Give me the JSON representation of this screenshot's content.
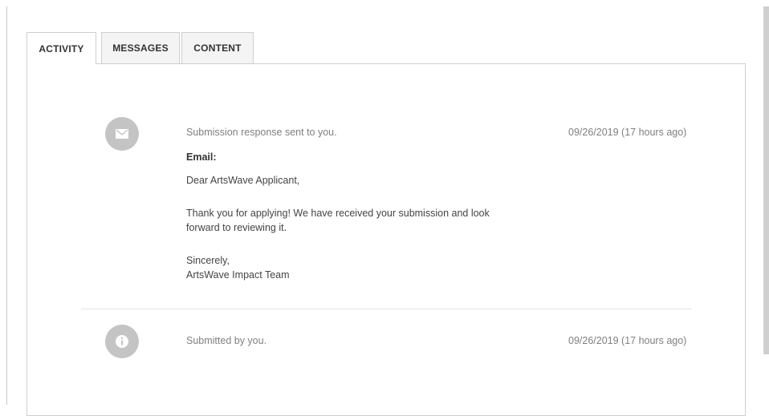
{
  "tabs": [
    {
      "label": "ACTIVITY",
      "active": true
    },
    {
      "label": "MESSAGES",
      "active": false
    },
    {
      "label": "CONTENT",
      "active": false
    }
  ],
  "activity": [
    {
      "icon": "envelope-icon",
      "title": "Submission response sent to you.",
      "date": "09/26/2019 (17 hours ago)",
      "email_label": "Email:",
      "greeting": "Dear ArtsWave Applicant,",
      "body_line1": "Thank you for applying! We have received your submission and look",
      "body_line2": "forward to reviewing it.",
      "closing": "Sincerely,",
      "signature": "ArtsWave Impact Team"
    },
    {
      "icon": "info-icon",
      "title": "Submitted by you.",
      "date": "09/26/2019 (17 hours ago)"
    }
  ],
  "colors": {
    "icon_bg": "#c4c4c4",
    "border": "#cfcfcf",
    "muted_text": "#808080"
  }
}
